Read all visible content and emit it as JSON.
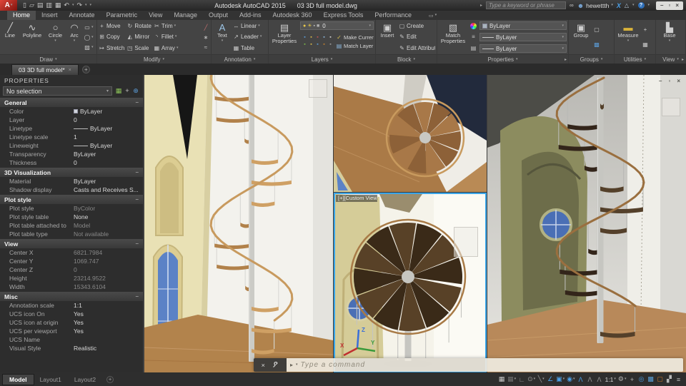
{
  "icons": {
    "caret": "▾",
    "collapse": "−",
    "launcher": "▸",
    "dropdown_arrow": "▸",
    "minimize": "–",
    "restore": "▫",
    "close": "×",
    "plus": "+",
    "binoculars": "∞",
    "user": "☻",
    "prompt": "▸"
  },
  "ui_colors": {
    "accent_blue": "#3aa5e8",
    "logo_red": "#c03a30",
    "status_blue": "#4ba0e8",
    "clean_screen_orange": "#c8782a"
  },
  "title_bar": {
    "logo_letter": "A",
    "app_title": "Autodesk AutoCAD 2015",
    "doc_title": "03 3D full model.dwg",
    "search_placeholder": "Type a keyword or phrase",
    "user_name": "hewettth",
    "exchange_icon": "X",
    "a360_icon": "△",
    "help_icon": "?",
    "qat": [
      {
        "name": "new-file-icon",
        "glyph": "▯"
      },
      {
        "name": "open-file-icon",
        "glyph": "▱"
      },
      {
        "name": "save-icon",
        "glyph": "▤"
      },
      {
        "name": "save-as-icon",
        "glyph": "▥"
      },
      {
        "name": "plot-icon",
        "glyph": "▦"
      },
      {
        "name": "undo-icon",
        "glyph": "↶",
        "dd": true
      },
      {
        "name": "redo-icon",
        "glyph": "↷",
        "dd": true
      }
    ]
  },
  "ribbon": {
    "display_toggle_icon": "▭",
    "tabs": [
      {
        "label": "Home",
        "active": true
      },
      {
        "label": "Insert"
      },
      {
        "label": "Annotate"
      },
      {
        "label": "Parametric"
      },
      {
        "label": "View"
      },
      {
        "label": "Manage"
      },
      {
        "label": "Output"
      },
      {
        "label": "Add-ins"
      },
      {
        "label": "Autodesk 360"
      },
      {
        "label": "Express Tools"
      },
      {
        "label": "Performance"
      }
    ],
    "panels": [
      {
        "label": "Draw",
        "width": 136,
        "type": "bigrow",
        "tools": [
          {
            "l": "Line",
            "g": "╱",
            "w": 24
          },
          {
            "l": "Polyline",
            "g": "∿",
            "w": 34
          },
          {
            "l": "Circle",
            "g": "○",
            "dd": true,
            "w": 27
          },
          {
            "l": "Arc",
            "g": "◠",
            "dd": true,
            "w": 22
          }
        ],
        "side": [
          {
            "n": "rectangle",
            "g": "▭"
          },
          {
            "n": "ellipse",
            "g": "◯"
          },
          {
            "n": "hatch",
            "g": "▨"
          }
        ]
      },
      {
        "label": "Modify",
        "width": 160,
        "type": "grid",
        "tools": [
          {
            "l": "Move",
            "g": "+"
          },
          {
            "l": "Copy",
            "g": "⊞"
          },
          {
            "l": "Stretch",
            "g": "↦"
          },
          {
            "l": "Rotate",
            "g": "↻"
          },
          {
            "l": "Mirror",
            "g": "◭"
          },
          {
            "l": "Scale",
            "g": "◳"
          },
          {
            "l": "Trim",
            "g": "✂",
            "dd": true
          },
          {
            "l": "Fillet",
            "g": "◝",
            "dd": true
          },
          {
            "l": "Array",
            "g": "▦",
            "dd": true
          }
        ],
        "side": [
          {
            "n": "erase",
            "g": "╱",
            "c": "#c87070"
          },
          {
            "n": "explode",
            "g": "∗"
          },
          {
            "n": "offset",
            "g": "≈"
          }
        ]
      },
      {
        "label": "Annotation",
        "width": 80,
        "type": "bigrows",
        "big": {
          "l": "Text",
          "g": "A",
          "gc": "#9ec7e8",
          "dd": true,
          "w": 26
        },
        "rows": [
          {
            "l": "Linear",
            "g": "↔",
            "dd": true
          },
          {
            "l": "Leader",
            "g": "↗",
            "dd": true
          },
          {
            "l": "Table",
            "g": "▦"
          }
        ]
      },
      {
        "label": "Layers",
        "width": 150,
        "type": "layers",
        "big": {
          "l": "Layer Properties",
          "g": "▤",
          "w": 40
        },
        "combo": {
          "value": "0",
          "icons": [
            {
              "n": "layer-on-bulb",
              "g": "●",
              "c": "#e8c84a"
            },
            {
              "n": "layer-sun",
              "g": "☀",
              "c": "#e8c84a"
            },
            {
              "n": "layer-lock",
              "g": "▪",
              "c": "#b8b8b8"
            },
            {
              "n": "layer-color-swatch",
              "g": "■",
              "c": "#b0b0b0"
            }
          ]
        },
        "grid_icons": [
          "#5b9bd5",
          "#d8b84a",
          "#c05050",
          "#8ab4d8",
          "#d0d0d0",
          "#7ab648",
          "#d8b84a",
          "#5b9bd5",
          "#c08030",
          "#9a9a9a"
        ],
        "rows": [
          {
            "l": "Make Current",
            "g": "✓",
            "gc": "#d8c050"
          },
          {
            "l": "Match Layer",
            "g": "▤",
            "gc": "#8ab4d8"
          }
        ]
      },
      {
        "label": "Block",
        "width": 86,
        "type": "bigrows",
        "big": {
          "l": "Insert",
          "g": "▣",
          "w": 28
        },
        "rows": [
          {
            "l": "Create",
            "g": "▢"
          },
          {
            "l": "Edit",
            "g": "✎"
          },
          {
            "l": "Edit Attributes",
            "g": "✎",
            "dd": true
          }
        ]
      },
      {
        "label": "Properties",
        "width": 184,
        "type": "props",
        "launcher": true,
        "big": {
          "l": "Match Properties",
          "g": "▧",
          "w": 40
        },
        "combos": [
          "ByLayer",
          "ByLayer",
          "ByLayer"
        ]
      },
      {
        "label": "Groups",
        "width": 64,
        "type": "bigside",
        "big": {
          "l": "Group",
          "g": "▣",
          "w": 30
        },
        "side": [
          {
            "n": "group-edit",
            "g": "▢"
          },
          {
            "n": "group-selectable",
            "g": "▩",
            "c": "#5b9bd5"
          }
        ]
      },
      {
        "label": "Utilities",
        "width": 58,
        "type": "bigside",
        "big": {
          "l": "Measure",
          "g": "▬",
          "gc": "#d8b23a",
          "dd": true,
          "w": 34
        },
        "side": [
          {
            "n": "id-point",
            "g": "+"
          },
          {
            "n": "quick-calculator",
            "g": "▦"
          }
        ]
      },
      {
        "label": "View",
        "width": 42,
        "type": "bigside",
        "launcher": true,
        "big": {
          "l": "Base",
          "g": "▙",
          "dd": true,
          "w": 34
        },
        "side": []
      }
    ]
  },
  "file_tabs": {
    "tabs": [
      {
        "label": "03 3D full model*",
        "active": true
      }
    ]
  },
  "properties_palette": {
    "title": "PROPERTIES",
    "selection": "No selection",
    "header_icons": [
      {
        "n": "toggle-value",
        "g": "▦",
        "c": "#8ac058"
      },
      {
        "n": "pick-add",
        "g": "+",
        "c": "#c8c8c8"
      },
      {
        "n": "quick-select",
        "g": "⊕",
        "c": "#5b9bd5"
      }
    ],
    "sections": [
      {
        "name": "General",
        "rows": [
          {
            "label": "Color",
            "value": "ByLayer",
            "swatch": true
          },
          {
            "label": "Layer",
            "value": "0"
          },
          {
            "label": "Linetype",
            "value": "ByLayer",
            "line": true
          },
          {
            "label": "Linetype scale",
            "value": "1"
          },
          {
            "label": "Lineweight",
            "value": "ByLayer",
            "line": true
          },
          {
            "label": "Transparency",
            "value": "ByLayer"
          },
          {
            "label": "Thickness",
            "value": "0"
          }
        ]
      },
      {
        "name": "3D Visualization",
        "rows": [
          {
            "label": "Material",
            "value": "ByLayer"
          },
          {
            "label": "Shadow display",
            "value": "Casts and Receives S..."
          }
        ]
      },
      {
        "name": "Plot style",
        "rows": [
          {
            "label": "Plot style",
            "value": "ByColor",
            "dim": true
          },
          {
            "label": "Plot style table",
            "value": "None"
          },
          {
            "label": "Plot table attached to",
            "value": "Model",
            "dim": true
          },
          {
            "label": "Plot table type",
            "value": "Not available",
            "dim": true
          }
        ]
      },
      {
        "name": "View",
        "rows": [
          {
            "label": "Center X",
            "value": "6821.7984",
            "dim": true
          },
          {
            "label": "Center Y",
            "value": "1069.747",
            "dim": true
          },
          {
            "label": "Center Z",
            "value": "0",
            "dim": true
          },
          {
            "label": "Height",
            "value": "23214.9522",
            "dim": true
          },
          {
            "label": "Width",
            "value": "15343.6104",
            "dim": true
          }
        ]
      },
      {
        "name": "Misc",
        "rows": [
          {
            "label": "Annotation scale",
            "value": "1:1"
          },
          {
            "label": "UCS icon On",
            "value": "Yes"
          },
          {
            "label": "UCS icon at origin",
            "value": "Yes"
          },
          {
            "label": "UCS per viewport",
            "value": "Yes"
          },
          {
            "label": "UCS Name",
            "value": ""
          },
          {
            "label": "Visual Style",
            "value": "Realistic"
          }
        ]
      }
    ]
  },
  "viewport": {
    "active_label": "[+][Custom View]",
    "ucs_x": "X",
    "ucs_y": "Y",
    "ucs_z": "Z"
  },
  "command_line": {
    "placeholder": "Type a command"
  },
  "status_bar": {
    "layout_tabs": [
      {
        "label": "Model",
        "active": true
      },
      {
        "label": "Layout1"
      },
      {
        "label": "Layout2"
      }
    ],
    "icons": [
      {
        "name": "grid-display-icon",
        "glyph": "▦",
        "color": "#c8c8c8"
      },
      {
        "name": "snap-mode-icon",
        "glyph": "▦",
        "color": "#707070",
        "dd": true
      },
      {
        "name": "ortho-mode-icon",
        "glyph": "∟",
        "color": "#9a9a9a"
      },
      {
        "name": "polar-tracking-icon",
        "glyph": "⊙",
        "color": "#9a9a9a",
        "dd": true
      },
      {
        "name": "isometric-drafting-icon",
        "glyph": "╲",
        "color": "#9a9a9a",
        "dd": true
      },
      {
        "name": "object-snap-tracking-icon",
        "glyph": "∠",
        "color": "#4ba0e8"
      },
      {
        "name": "object-snap-icon",
        "glyph": "▣",
        "color": "#4ba0e8",
        "dd": true
      },
      {
        "name": "object-snap-3d-icon",
        "glyph": "◉",
        "color": "#4ba0e8",
        "dd": true
      },
      {
        "name": "annotation-visibility-icon",
        "glyph": "Λ",
        "color": "#4ba0e8"
      },
      {
        "name": "annotation-autoscale-icon",
        "glyph": "Λ",
        "color": "#9a9a9a"
      },
      {
        "name": "annotation-scale-icon",
        "glyph": "Λ",
        "color": "#9a9a9a"
      },
      {
        "name": "annotation-scale-value",
        "text": "1:1",
        "color": "#d8d8d8",
        "dd": true
      },
      {
        "name": "workspace-switching-icon",
        "glyph": "⚙",
        "color": "#b8b8b8",
        "dd": true
      },
      {
        "name": "customization-plus-icon",
        "glyph": "+",
        "color": "#b8b8b8"
      },
      {
        "name": "isolate-objects-icon",
        "glyph": "◎",
        "color": "#4ba0e8"
      },
      {
        "name": "graphics-performance-icon",
        "glyph": "▩",
        "color": "#5aa0d8"
      },
      {
        "name": "clean-screen-icon",
        "glyph": "▢",
        "color": "#c8782a"
      },
      {
        "name": "fullscreen-icon",
        "glyph": "▞",
        "color": "#b8b8b8"
      },
      {
        "name": "customization-menu-icon",
        "glyph": "≡",
        "color": "#b8b8b8"
      }
    ]
  }
}
